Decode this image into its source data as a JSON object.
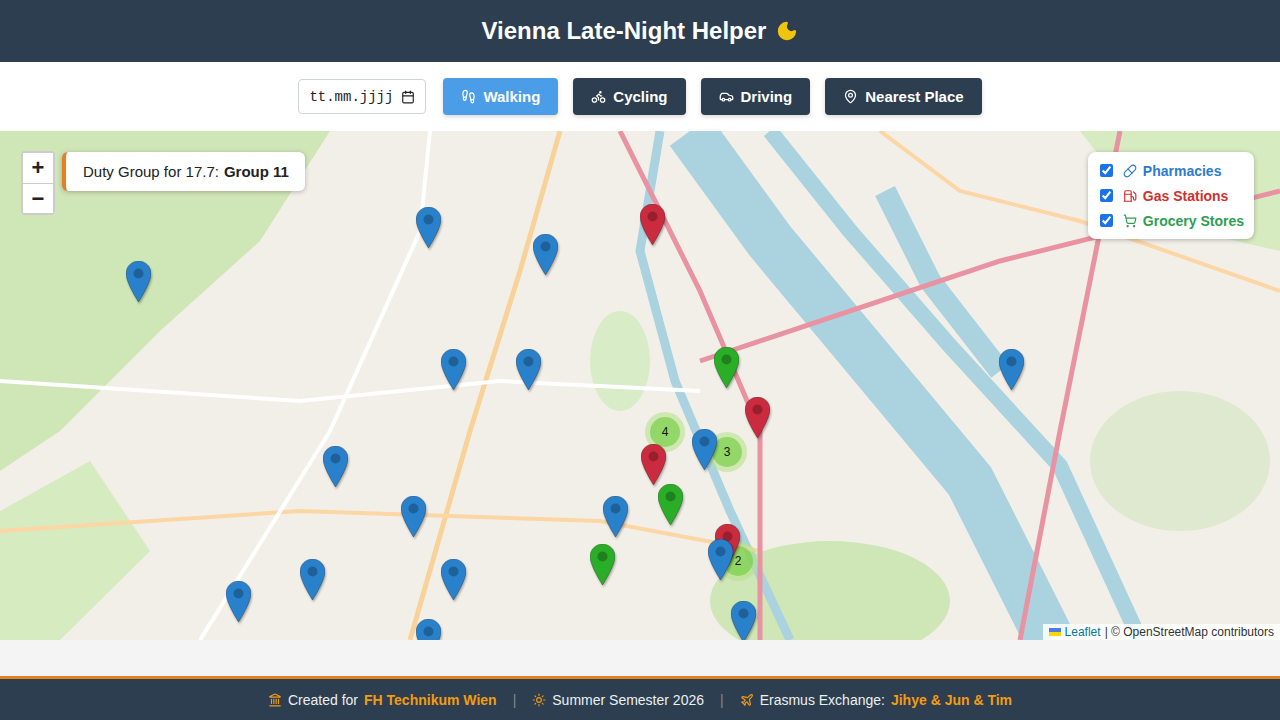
{
  "header": {
    "title": "Vienna Late-Night Helper"
  },
  "toolbar": {
    "date_placeholder": "tt.mm.jjjj",
    "modes": [
      {
        "label": "Walking",
        "selected": true
      },
      {
        "label": "Cycling",
        "selected": false
      },
      {
        "label": "Driving",
        "selected": false
      },
      {
        "label": "Nearest Place",
        "selected": false
      }
    ]
  },
  "map": {
    "zoom": [
      "+",
      "−"
    ],
    "duty": {
      "label": "Duty Group for 17.7:",
      "value": "Group 11"
    },
    "legend": [
      {
        "label": "Pharmacies",
        "checked": true,
        "color": "#2b7bd0"
      },
      {
        "label": "Gas Stations",
        "checked": true,
        "color": "#d0312d"
      },
      {
        "label": "Grocery Stores",
        "checked": true,
        "color": "#2e9e4f"
      }
    ],
    "pins": [
      {
        "kind": "gas",
        "color": "#cb2b3e"
      },
      {
        "kind": "gas",
        "color": "#cb2b3e"
      },
      {
        "kind": "gas",
        "color": "#cb2b3e"
      },
      {
        "kind": "gas",
        "color": "#cb2b3e"
      },
      {
        "kind": "grocery",
        "color": "#2aad27"
      },
      {
        "kind": "grocery",
        "color": "#2aad27"
      },
      {
        "kind": "grocery",
        "color": "#2aad27"
      },
      {
        "kind": "pharmacy",
        "color": "#2a81cb"
      },
      {
        "kind": "pharmacy",
        "color": "#2a81cb"
      },
      {
        "kind": "pharmacy",
        "color": "#2a81cb"
      },
      {
        "kind": "pharmacy",
        "color": "#2a81cb"
      },
      {
        "kind": "pharmacy",
        "color": "#2a81cb"
      },
      {
        "kind": "pharmacy",
        "color": "#2a81cb"
      },
      {
        "kind": "pharmacy",
        "color": "#2a81cb"
      },
      {
        "kind": "pharmacy",
        "color": "#2a81cb"
      },
      {
        "kind": "pharmacy",
        "color": "#2a81cb"
      },
      {
        "kind": "pharmacy",
        "color": "#2a81cb"
      },
      {
        "kind": "pharmacy",
        "color": "#2a81cb"
      },
      {
        "kind": "pharmacy",
        "color": "#2a81cb"
      },
      {
        "kind": "pharmacy",
        "color": "#2a81cb"
      },
      {
        "kind": "pharmacy",
        "color": "#2a81cb"
      },
      {
        "kind": "pharmacy",
        "color": "#2a81cb"
      },
      {
        "kind": "pharmacy",
        "color": "#2a81cb"
      }
    ],
    "clusters": [
      {
        "count": "4"
      },
      {
        "count": "3"
      },
      {
        "count": "2"
      }
    ],
    "attribution": {
      "link": "Leaflet",
      "text": "| © OpenStreetMap contributors"
    }
  },
  "footer": {
    "separator": "|",
    "items": [
      {
        "text": "Created for",
        "highlight": "FH Technikum Wien"
      },
      {
        "text": "Summer Semester 2026"
      },
      {
        "text": "Erasmus Exchange:",
        "highlight": "Jihye & Jun & Tim"
      }
    ]
  }
}
